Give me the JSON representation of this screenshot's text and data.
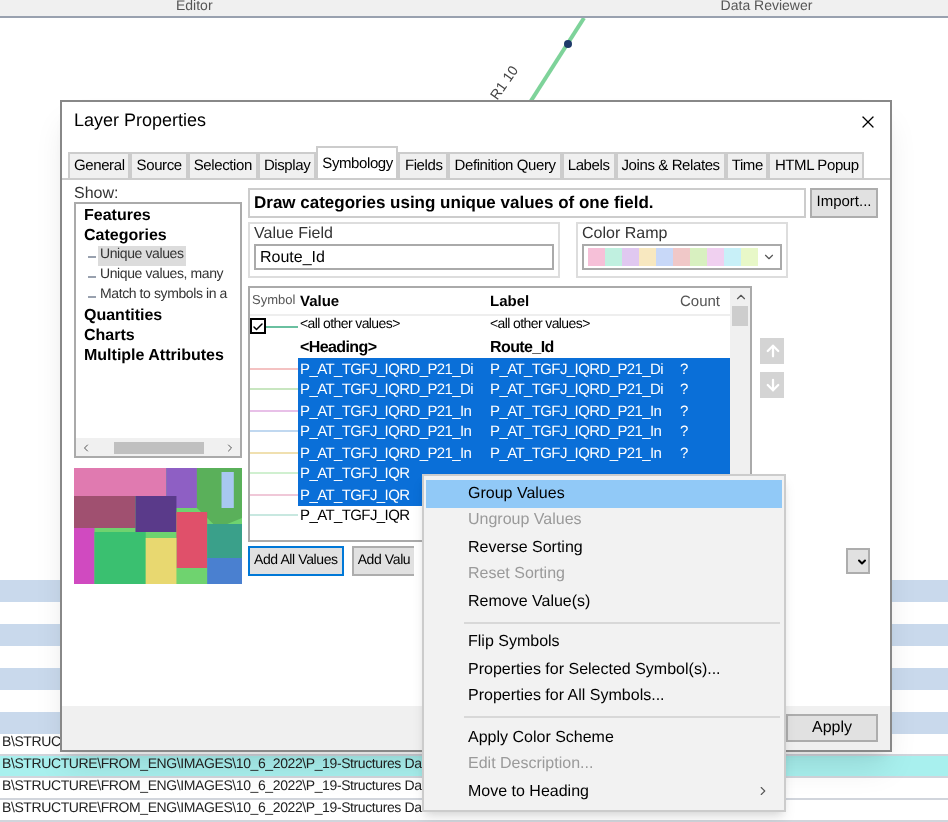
{
  "toolbar": {
    "items": [
      "Editor",
      "Data Reviewer"
    ]
  },
  "map": {
    "line_label": "R1 10"
  },
  "attribute_table": {
    "rows": [
      {
        "text": "B\\STRUC",
        "selected": false
      },
      {
        "text": "B\\STRUCTURE\\FROM_ENG\\IMAGES\\10_6_2022\\P_19-Structures Da",
        "selected": true
      },
      {
        "text": "B\\STRUCTURE\\FROM_ENG\\IMAGES\\10_6_2022\\P_19-Structures Da",
        "selected": false
      },
      {
        "text": "B\\STRUCTURE\\FROM_ENG\\IMAGES\\10_6_2022\\P_19-Structures Da",
        "selected": false
      }
    ]
  },
  "dialog": {
    "title": "Layer Properties",
    "tabs": [
      {
        "label": "General",
        "selected": false
      },
      {
        "label": "Source",
        "selected": false
      },
      {
        "label": "Selection",
        "selected": false
      },
      {
        "label": "Display",
        "selected": false
      },
      {
        "label": "Symbology",
        "selected": true
      },
      {
        "label": "Fields",
        "selected": false
      },
      {
        "label": "Definition Query",
        "selected": false
      },
      {
        "label": "Labels",
        "selected": false
      },
      {
        "label": "Joins & Relates",
        "selected": false
      },
      {
        "label": "Time",
        "selected": false
      },
      {
        "label": "HTML Popup",
        "selected": false
      }
    ],
    "show_label": "Show:",
    "show_tree": [
      {
        "label": "Features",
        "selected": false
      },
      {
        "label": "Categories",
        "selected": false,
        "children": [
          {
            "label": "Unique values",
            "selected": true
          },
          {
            "label": "Unique values, many",
            "selected": false
          },
          {
            "label": "Match to symbols in a",
            "selected": false
          }
        ]
      },
      {
        "label": "Quantities",
        "selected": false
      },
      {
        "label": "Charts",
        "selected": false
      },
      {
        "label": "Multiple Attributes",
        "selected": false
      }
    ],
    "description": "Draw categories using unique values of one field.",
    "import_button": "Import...",
    "value_field": {
      "label": "Value Field",
      "value": "Route_Id"
    },
    "color_ramp": {
      "label": "Color Ramp"
    },
    "table": {
      "columns": [
        "Symbol",
        "Value",
        "Label",
        "Count"
      ],
      "rows": [
        {
          "kind": "other",
          "checked": true,
          "value": "<all other values>",
          "label": "<all other values>"
        },
        {
          "kind": "heading",
          "value": "<Heading>",
          "label": "Route_Id"
        },
        {
          "kind": "value",
          "selected": true,
          "color": "#f4c2c2",
          "value": "P_AT_TGFJ_IQRD_P21_Di",
          "label": "P_AT_TGFJ_IQRD_P21_Di",
          "count": "?"
        },
        {
          "kind": "value",
          "selected": true,
          "color": "#c8e6c0",
          "value": "P_AT_TGFJ_IQRD_P21_Di",
          "label": "P_AT_TGFJ_IQRD_P21_Di",
          "count": "?"
        },
        {
          "kind": "value",
          "selected": true,
          "color": "#e8c0e8",
          "value": "P_AT_TGFJ_IQRD_P21_In",
          "label": "P_AT_TGFJ_IQRD_P21_In",
          "count": "?"
        },
        {
          "kind": "value",
          "selected": true,
          "color": "#c0d8f0",
          "value": "P_AT_TGFJ_IQRD_P21_In",
          "label": "P_AT_TGFJ_IQRD_P21_In",
          "count": "?"
        },
        {
          "kind": "value",
          "selected": true,
          "color": "#f0e0b0",
          "value": "P_AT_TGFJ_IQRD_P21_In",
          "label": "P_AT_TGFJ_IQRD_P21_In",
          "count": "?"
        },
        {
          "kind": "value",
          "selected": true,
          "color": "#d0f0d0",
          "value": "P_AT_TGFJ_IQR"
        },
        {
          "kind": "value",
          "selected": true,
          "color": "#f0c8d8",
          "value": "P_AT_TGFJ_IQR"
        },
        {
          "kind": "value",
          "selected": false,
          "color": "#c8e8e0",
          "value": "P_AT_TGFJ_IQR"
        }
      ]
    },
    "buttons": [
      "Add All Values",
      "Add Valu"
    ],
    "footer_buttons": [
      "Apply"
    ]
  },
  "context_menu": [
    {
      "kind": "item",
      "label": "Group Values",
      "selected": true,
      "disabled": false
    },
    {
      "kind": "item",
      "label": "Ungroup Values",
      "selected": false,
      "disabled": true
    },
    {
      "kind": "item",
      "label": "Reverse Sorting",
      "selected": false,
      "disabled": false
    },
    {
      "kind": "item",
      "label": "Reset Sorting",
      "selected": false,
      "disabled": true
    },
    {
      "kind": "item",
      "label": "Remove Value(s)",
      "selected": false,
      "disabled": false
    },
    {
      "kind": "separator"
    },
    {
      "kind": "item",
      "label": "Flip Symbols",
      "selected": false,
      "disabled": false
    },
    {
      "kind": "item",
      "label": "Properties for Selected Symbol(s)...",
      "selected": false,
      "disabled": false
    },
    {
      "kind": "item",
      "label": "Properties for All Symbols...",
      "selected": false,
      "disabled": false
    },
    {
      "kind": "separator"
    },
    {
      "kind": "item",
      "label": "Apply Color Scheme",
      "selected": false,
      "disabled": false
    },
    {
      "kind": "item",
      "label": "Edit Description...",
      "selected": false,
      "disabled": true
    },
    {
      "kind": "submenu",
      "label": "Move to Heading",
      "selected": false,
      "disabled": false
    }
  ]
}
